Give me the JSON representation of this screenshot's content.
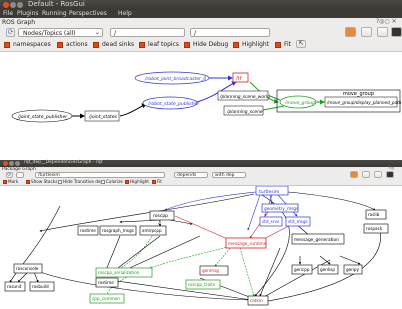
{
  "win1": {
    "title": "Default - RosGui",
    "menu": [
      "File",
      "Plugins",
      "Running",
      "Perspectives",
      "Help"
    ],
    "panel_title": "ROS Graph",
    "mode_select": "Nodes/Topics (all)",
    "filter_value": "/",
    "checks": [
      "namespaces",
      "actions",
      "dead sinks",
      "leaf topics",
      "Hide Debug",
      "Highlight",
      "Fit"
    ],
    "nodes": {
      "broadcaster": "/robot_joint_broadcaster_0",
      "tf": "/tf",
      "robot_state": "/robot_state_publisher",
      "planning_world": "/planning_scene_world",
      "planning_scene": "/planning_scene",
      "move_group_ns": "move_group",
      "move_group": "/move_group",
      "display_path": "/move_group/display_planned_path",
      "jsp": "/joint_state_publisher",
      "joint_states": "/joint_states"
    }
  },
  "win2": {
    "title": "rqt_dep__DependenciesGraph - rqt",
    "panel_title": "Package Graph",
    "pkg_value": "/turtlesim",
    "depth1": "depends",
    "depth2": "with dep",
    "checks": [
      "Mark",
      "Show Stacks",
      "Hide Transitive deps",
      "Colorize",
      "Highlight",
      "Fit"
    ],
    "nodes": {
      "turtlesim": "turtlesim",
      "roscpp": "roscpp",
      "geometry_msgs": "geometry_msgs",
      "rosgraph_msgs": "rosgraph_msgs",
      "std_srvs": "std_srvs",
      "std_msgs": "std_msgs",
      "rostime": "rostime",
      "rosgraph_msgs2": "rosgraph_msgs",
      "xmlrpcpp": "xmlrpcpp",
      "message_runtime": "message_runtime",
      "message_generation": "message_generation",
      "roslib": "roslib",
      "rospack": "rospack",
      "roscpp_serialization": "roscpp_serialization",
      "genmsg": "genmsg",
      "gencpp": "gencpp",
      "genlisp": "genlisp",
      "genpy": "genpy",
      "rosconsole": "rosconsole",
      "rosunit": "rosunit",
      "rosbuild": "rosbuild",
      "rosbuild2": "rostime",
      "roscpp_traits": "roscpp_traits",
      "cpp_common": "cpp_common",
      "catkin": "catkin"
    }
  },
  "colors": {
    "accent": "#df4a16",
    "blue": "#2e34d6",
    "green": "#1f9d1f",
    "red": "#d61f1f"
  }
}
